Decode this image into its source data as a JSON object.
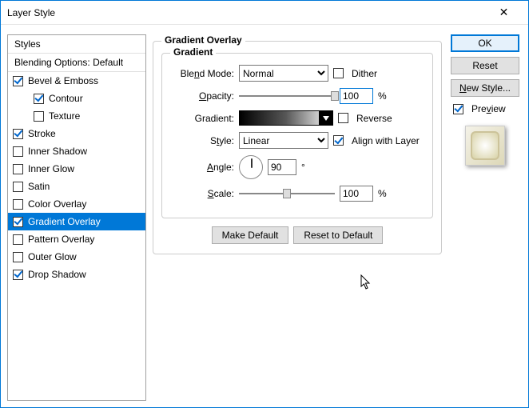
{
  "title": "Layer Style",
  "styles_header": "Styles",
  "blending_options": "Blending Options: Default",
  "style_list": [
    {
      "label": "Bevel & Emboss",
      "checked": true,
      "indent": false,
      "selected": false
    },
    {
      "label": "Contour",
      "checked": true,
      "indent": true,
      "selected": false
    },
    {
      "label": "Texture",
      "checked": false,
      "indent": true,
      "selected": false
    },
    {
      "label": "Stroke",
      "checked": true,
      "indent": false,
      "selected": false
    },
    {
      "label": "Inner Shadow",
      "checked": false,
      "indent": false,
      "selected": false
    },
    {
      "label": "Inner Glow",
      "checked": false,
      "indent": false,
      "selected": false
    },
    {
      "label": "Satin",
      "checked": false,
      "indent": false,
      "selected": false
    },
    {
      "label": "Color Overlay",
      "checked": false,
      "indent": false,
      "selected": false
    },
    {
      "label": "Gradient Overlay",
      "checked": true,
      "indent": false,
      "selected": true
    },
    {
      "label": "Pattern Overlay",
      "checked": false,
      "indent": false,
      "selected": false
    },
    {
      "label": "Outer Glow",
      "checked": false,
      "indent": false,
      "selected": false
    },
    {
      "label": "Drop Shadow",
      "checked": true,
      "indent": false,
      "selected": false
    }
  ],
  "panel": {
    "title": "Gradient Overlay",
    "section": "Gradient",
    "blend_mode_label": "Blend Mode:",
    "blend_mode_value": "Normal",
    "dither_label": "Dither",
    "dither_checked": false,
    "opacity_label": "Opacity:",
    "opacity_value": "100",
    "opacity_unit": "%",
    "gradient_label": "Gradient:",
    "reverse_label": "Reverse",
    "reverse_checked": false,
    "style_label": "Style:",
    "style_value": "Linear",
    "align_label": "Align with Layer",
    "align_checked": true,
    "angle_label": "Angle:",
    "angle_value": "90",
    "angle_unit": "°",
    "scale_label": "Scale:",
    "scale_value": "100",
    "scale_unit": "%",
    "make_default": "Make Default",
    "reset_default": "Reset to Default"
  },
  "buttons": {
    "ok": "OK",
    "reset": "Reset",
    "new_style": "New Style...",
    "preview": "Preview",
    "preview_checked": true
  }
}
